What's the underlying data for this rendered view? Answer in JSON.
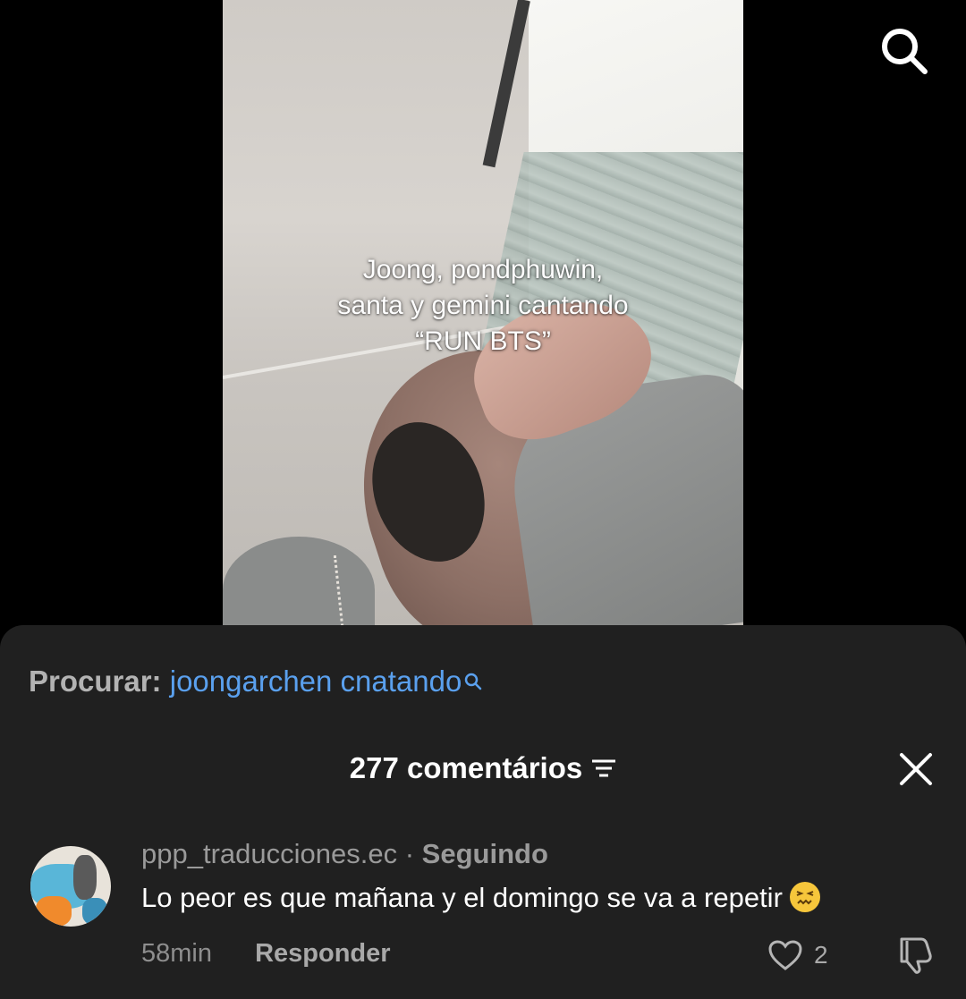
{
  "video": {
    "caption_lines": [
      "Joong, pondphuwin,",
      "santa y gemini cantando",
      "“RUN BTS”"
    ]
  },
  "top_bar": {
    "search_icon": "search-icon"
  },
  "search_suggestion": {
    "prefix": "Procurar:",
    "term": "joongarchen cnatando"
  },
  "comments_panel": {
    "title": "277 comentários",
    "filter_icon": "filter-icon",
    "close_icon": "close-icon"
  },
  "comments": [
    {
      "username": "ppp_traducciones.ec",
      "separator": "·",
      "follow_status": "Seguindo",
      "text": "Lo peor es que mañana y el domingo se va a repetir",
      "emoji": "confounded-face",
      "time": "58min",
      "reply_label": "Responder",
      "like_count": "2"
    }
  ],
  "colors": {
    "sheet_bg": "#202020",
    "link_blue": "#5aa0ee",
    "muted_text": "#9a9a9a"
  }
}
